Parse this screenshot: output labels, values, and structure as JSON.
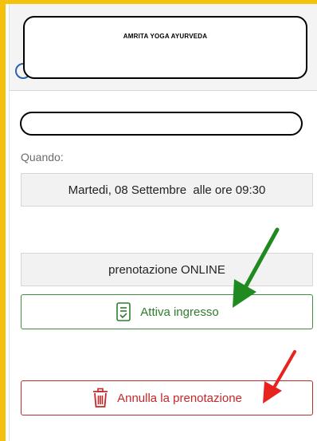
{
  "header": {
    "logo_text": "AMRITA YOGA AYURVEDA"
  },
  "booking": {
    "when_label": "Quando:",
    "date_text": "Martedi, 08 Settembre  alle ore 09:30",
    "mode_text": "prenotazione ONLINE"
  },
  "actions": {
    "activate_entry_label": "Attiva ingresso",
    "cancel_booking_label": "Annulla la prenotazione"
  },
  "icons": {
    "activate_entry": "checklist-document-icon",
    "cancel_booking": "trash-icon"
  },
  "colors": {
    "frame": "#f4c20d",
    "activate_accent": "#2e7d2e",
    "cancel_accent": "#c62828",
    "arrow_green": "#1f8a1f",
    "arrow_red": "#e8231f"
  }
}
